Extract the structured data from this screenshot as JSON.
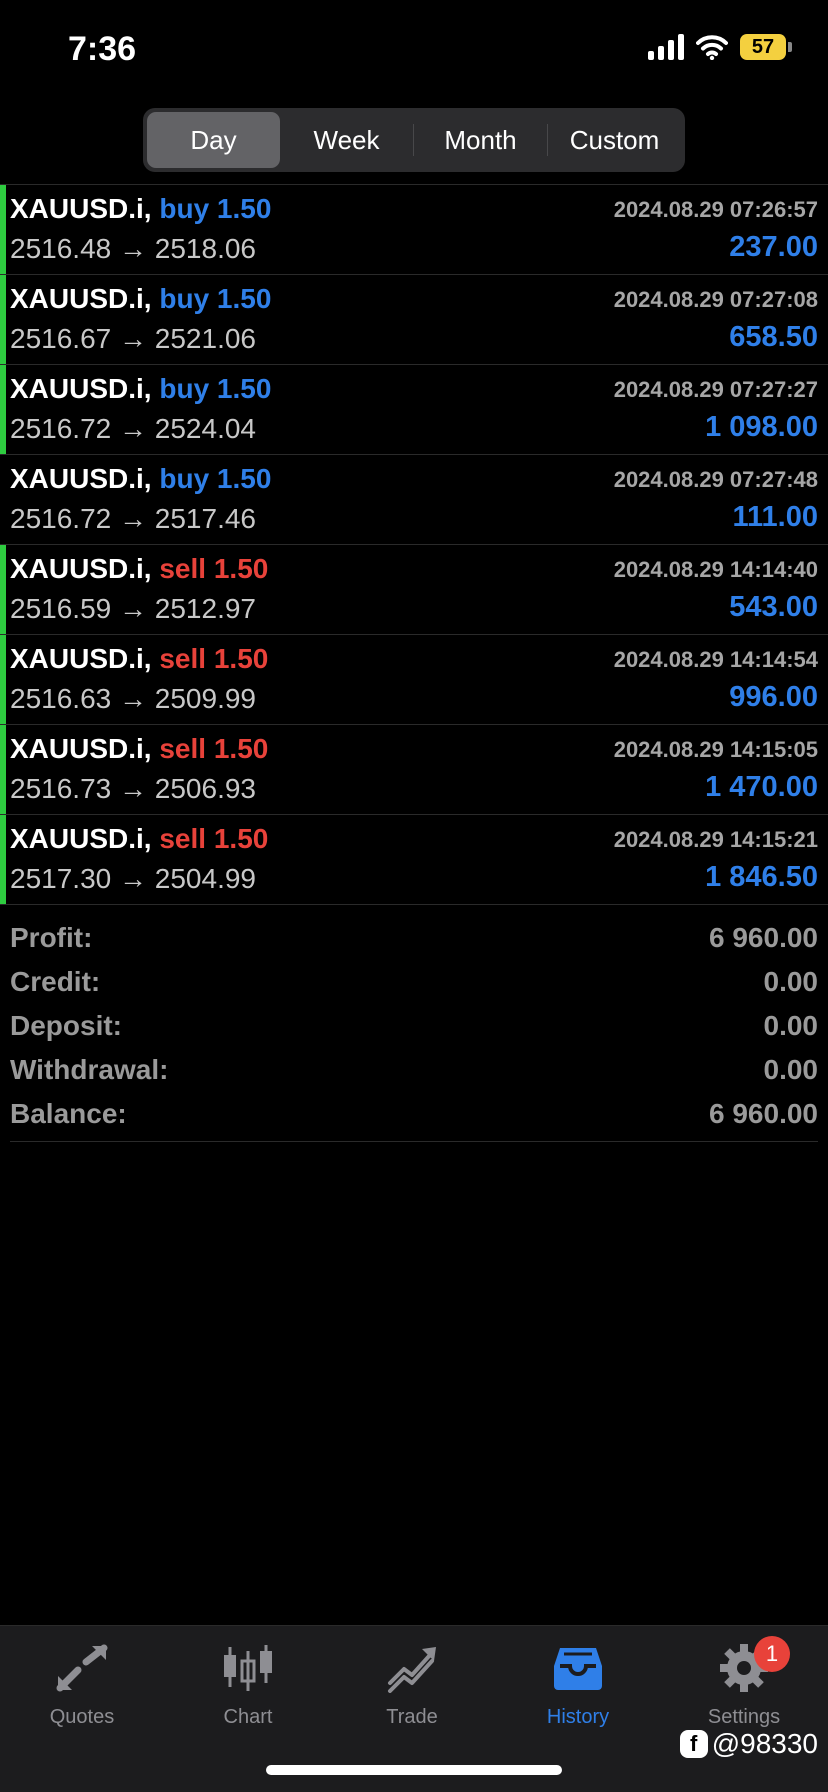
{
  "status_bar": {
    "time": "7:36",
    "battery": "57"
  },
  "period_tabs": [
    {
      "label": "Day",
      "active": true
    },
    {
      "label": "Week",
      "active": false
    },
    {
      "label": "Month",
      "active": false
    },
    {
      "label": "Custom",
      "active": false
    }
  ],
  "deals": [
    {
      "symbol": "XAUUSD.i,",
      "type": "buy",
      "volume": "1.50",
      "open": "2516.48",
      "close": "2518.06",
      "time": "2024.08.29 07:26:57",
      "profit": "237.00",
      "accent": true
    },
    {
      "symbol": "XAUUSD.i,",
      "type": "buy",
      "volume": "1.50",
      "open": "2516.67",
      "close": "2521.06",
      "time": "2024.08.29 07:27:08",
      "profit": "658.50",
      "accent": true
    },
    {
      "symbol": "XAUUSD.i,",
      "type": "buy",
      "volume": "1.50",
      "open": "2516.72",
      "close": "2524.04",
      "time": "2024.08.29 07:27:27",
      "profit": "1 098.00",
      "accent": true
    },
    {
      "symbol": "XAUUSD.i,",
      "type": "buy",
      "volume": "1.50",
      "open": "2516.72",
      "close": "2517.46",
      "time": "2024.08.29 07:27:48",
      "profit": "111.00",
      "accent": false
    },
    {
      "symbol": "XAUUSD.i,",
      "type": "sell",
      "volume": "1.50",
      "open": "2516.59",
      "close": "2512.97",
      "time": "2024.08.29 14:14:40",
      "profit": "543.00",
      "accent": true
    },
    {
      "symbol": "XAUUSD.i,",
      "type": "sell",
      "volume": "1.50",
      "open": "2516.63",
      "close": "2509.99",
      "time": "2024.08.29 14:14:54",
      "profit": "996.00",
      "accent": true
    },
    {
      "symbol": "XAUUSD.i,",
      "type": "sell",
      "volume": "1.50",
      "open": "2516.73",
      "close": "2506.93",
      "time": "2024.08.29 14:15:05",
      "profit": "1 470.00",
      "accent": true
    },
    {
      "symbol": "XAUUSD.i,",
      "type": "sell",
      "volume": "1.50",
      "open": "2517.30",
      "close": "2504.99",
      "time": "2024.08.29 14:15:21",
      "profit": "1 846.50",
      "accent": true
    }
  ],
  "arrow": "→",
  "summary": [
    {
      "label": "Profit:",
      "value": "6 960.00"
    },
    {
      "label": "Credit:",
      "value": "0.00"
    },
    {
      "label": "Deposit:",
      "value": "0.00"
    },
    {
      "label": "Withdrawal:",
      "value": "0.00"
    },
    {
      "label": "Balance:",
      "value": "6 960.00"
    }
  ],
  "tab_bar": [
    {
      "label": "Quotes",
      "icon": "quotes-icon",
      "active": false
    },
    {
      "label": "Chart",
      "icon": "chart-icon",
      "active": false
    },
    {
      "label": "Trade",
      "icon": "trade-icon",
      "active": false
    },
    {
      "label": "History",
      "icon": "history-icon",
      "active": true
    },
    {
      "label": "Settings",
      "icon": "gear-icon",
      "active": false,
      "badge": "1"
    }
  ],
  "watermark": "@98330",
  "colors": {
    "buy": "#2f7fe8",
    "sell": "#e8423a",
    "accent": "#2ecc40",
    "active_tab": "#2f7fe8"
  }
}
